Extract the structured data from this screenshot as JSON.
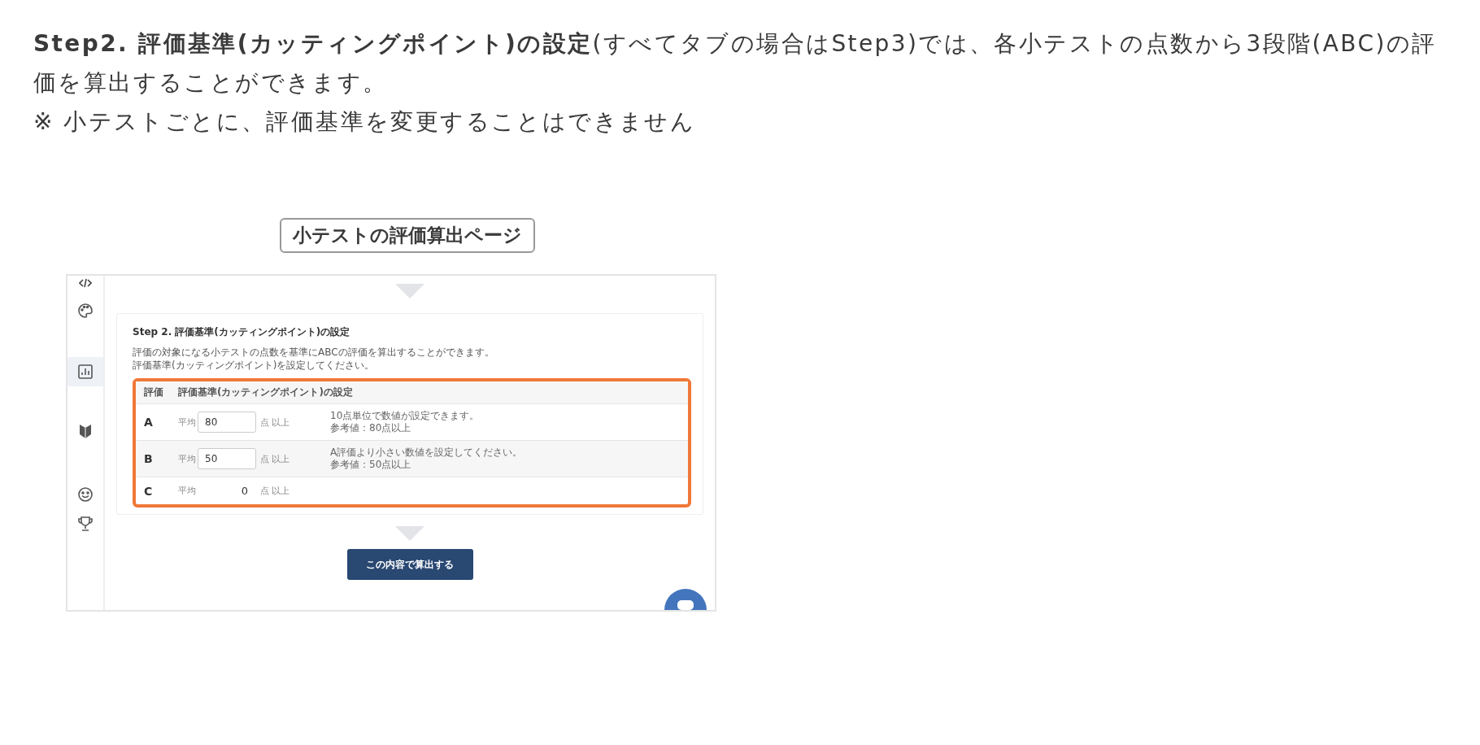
{
  "intro": {
    "paragraph": "**Step2. 評価基準(カッティングポイント)の設定**(すべてタブの場合はStep3)では、各小テストの点数から3段階(ABC)の評価を算出することができます。",
    "note": "※ 小テストごとに、評価基準を変更することはできません"
  },
  "caption": "小テストの評価算出ページ",
  "screen": {
    "sidebar": {
      "items": [
        {
          "selected": false
        },
        {
          "selected": false
        },
        {
          "selected": true
        },
        {
          "selected": false
        },
        {
          "selected": false
        },
        {
          "selected": false
        }
      ]
    },
    "card": {
      "title": "Step 2. 評価基準(カッティングポイント)の設定",
      "description": [
        "評価の対象になる小テストの点数を基準にABCの評価を算出することができます。",
        "評価基準(カッティングポイント)を設定してください。"
      ],
      "table": {
        "columns": [
          "評価",
          "評価基準(カッティングポイント)の設定"
        ],
        "rows": [
          {
            "grade": "A",
            "prefix": "平均",
            "kind": "input",
            "value": "80",
            "suffix": "点 以上",
            "hints": [
              "10点単位で数値が設定できます。",
              "参考値：80点以上"
            ]
          },
          {
            "grade": "B",
            "prefix": "平均",
            "kind": "input",
            "value": "50",
            "suffix": "点 以上",
            "hints": [
              "A評価より小さい数値を設定してください。",
              "参考値：50点以上"
            ]
          },
          {
            "grade": "C",
            "prefix": "平均",
            "kind": "fixed",
            "value": "0",
            "suffix": "点 以上"
          }
        ]
      }
    },
    "submit_button": "この内容で算出する"
  }
}
